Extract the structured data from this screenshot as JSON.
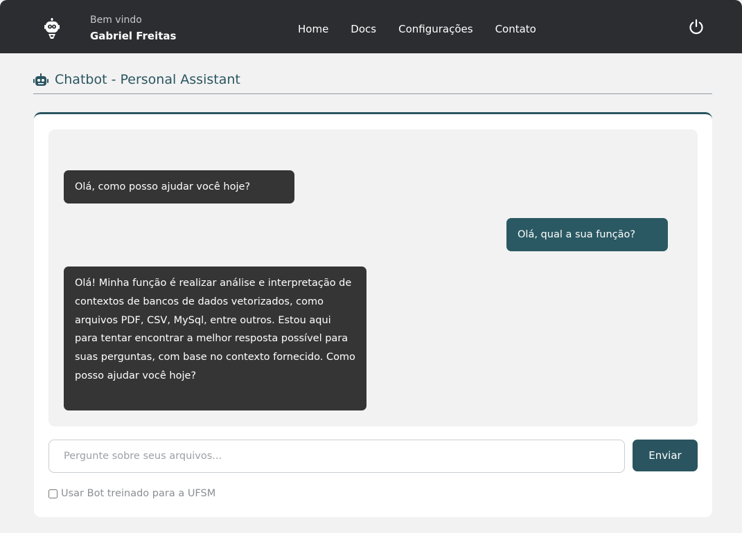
{
  "navbar": {
    "greeting": "Bem vindo",
    "user_name": "Gabriel Freitas",
    "links": [
      {
        "label": "Home"
      },
      {
        "label": "Docs"
      },
      {
        "label": "Configurações"
      },
      {
        "label": "Contato"
      }
    ],
    "logo_icon": "robot-logo-icon",
    "logout_icon": "power-icon"
  },
  "page": {
    "title": "Chatbot - Personal Assistant",
    "title_icon": "robot-icon"
  },
  "chat": {
    "messages": [
      {
        "sender": "bot",
        "text": "Olá, como posso ajudar você hoje?"
      },
      {
        "sender": "user",
        "text": "Olá, qual a sua função?"
      },
      {
        "sender": "bot",
        "text": "Olá! Minha função é realizar análise e interpretação de contextos de bancos de dados vetorizados, como arquivos PDF, CSV, MySql, entre outros. Estou aqui para tentar encontrar a melhor resposta possível para suas perguntas, com base no contexto fornecido. Como posso ajudar você hoje?"
      }
    ]
  },
  "input": {
    "placeholder": "Pergunte sobre seus arquivos...",
    "value": ""
  },
  "send_button": {
    "label": "Enviar"
  },
  "ufsm_option": {
    "label": "Usar Bot treinado para a UFSM",
    "checked": false
  },
  "colors": {
    "navbar_bg": "#2b2d31",
    "accent": "#2a5560",
    "bot_bubble": "#353535",
    "user_bubble": "#2a5963",
    "page_bg": "#f2f2f2"
  }
}
